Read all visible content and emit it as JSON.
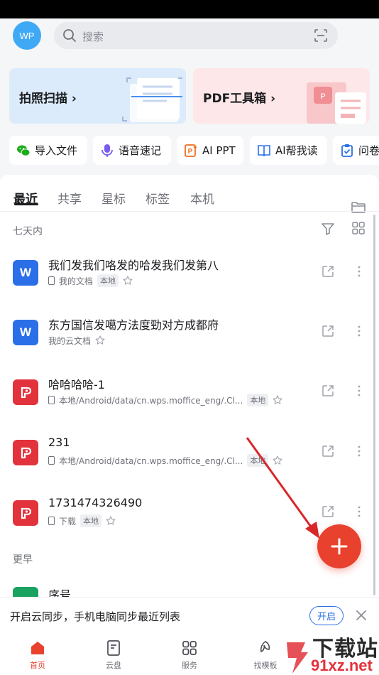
{
  "header": {
    "avatar_text": "WP",
    "search_placeholder": "搜索"
  },
  "cards": {
    "scan": "拍照扫描",
    "pdf": "PDF工具箱"
  },
  "quick_actions": [
    {
      "label": "导入文件",
      "icon": "wechat-icon",
      "color": "#1aad19"
    },
    {
      "label": "语音速记",
      "icon": "voice-note-icon",
      "color": "#7a5cf0"
    },
    {
      "label": "AI PPT",
      "icon": "ai-ppt-icon",
      "color": "#f26b1d"
    },
    {
      "label": "AI帮我读",
      "icon": "ai-read-icon",
      "color": "#2a6fe8"
    },
    {
      "label": "问卷",
      "icon": "survey-icon",
      "color": "#2a6fe8"
    }
  ],
  "tabs": [
    "最近",
    "共享",
    "星标",
    "标签",
    "本机"
  ],
  "sections": {
    "recent": "七天内",
    "earlier": "更早"
  },
  "files": [
    {
      "name": "我们发我们咯发的哈发我们发第八",
      "location": "我的文档",
      "tag": "本地",
      "type": "word",
      "icon_text": "W",
      "show_phone": true
    },
    {
      "name": "东方国信发噶方法度勁对方成都府",
      "location": "我的云文档",
      "tag": "",
      "type": "word",
      "icon_text": "W",
      "show_phone": false
    },
    {
      "name": "哈哈哈哈-1",
      "location": "本地/Android/data/cn.wps.moffice_eng/.Cl...",
      "tag": "本地",
      "type": "pdf",
      "icon_text": "",
      "show_phone": true
    },
    {
      "name": "231",
      "location": "本地/Android/data/cn.wps.moffice_eng/.Cl...",
      "tag": "本地",
      "type": "pdf",
      "icon_text": "",
      "show_phone": true
    },
    {
      "name": "1731474326490",
      "location": "下载",
      "tag": "本地",
      "type": "pdf",
      "icon_text": "",
      "show_phone": true
    }
  ],
  "earlier_file": {
    "name": "序号"
  },
  "sync_bar": {
    "text": "开启云同步，手机电脑同步最近列表",
    "button": "开启"
  },
  "bottom_nav": [
    {
      "label": "首页",
      "icon": "home-icon",
      "active": true
    },
    {
      "label": "云盘",
      "icon": "cloud-doc-icon",
      "active": false
    },
    {
      "label": "服务",
      "icon": "apps-grid-icon",
      "active": false
    },
    {
      "label": "找模板",
      "icon": "template-icon",
      "active": false
    }
  ],
  "watermark": {
    "text": "下载站",
    "url": "91xz.net"
  },
  "colors": {
    "accent_red": "#e8412e",
    "word_blue": "#2a6fe8",
    "pdf_red": "#e2323b"
  }
}
